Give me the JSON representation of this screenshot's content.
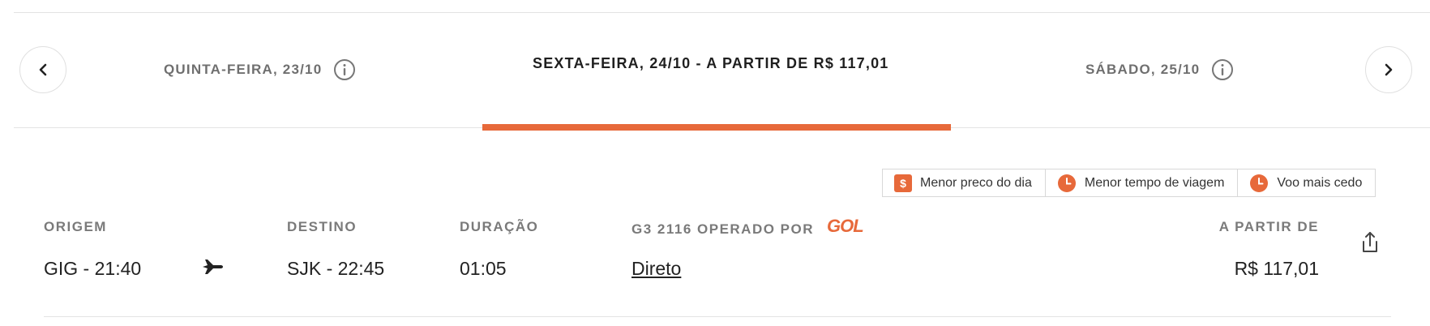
{
  "dates": {
    "previous": {
      "label": "QUINTA-FEIRA, 23/10"
    },
    "active": {
      "label": "SEXTA-FEIRA, 24/10 - A PARTIR DE R$ 117,01"
    },
    "next": {
      "label": "SÁBADO, 25/10"
    }
  },
  "icons": {
    "prev": "chevron-left-icon",
    "next": "chevron-right-icon",
    "info": "info-icon",
    "dollar": "dollar-badge-icon",
    "clock": "clock-icon",
    "plane": "plane-icon",
    "share": "share-icon"
  },
  "legend": {
    "items": [
      {
        "label": "Menor preco do dia",
        "icon": "$"
      },
      {
        "label": "Menor tempo de viagem"
      },
      {
        "label": "Voo mais cedo"
      }
    ]
  },
  "flight": {
    "origin_label": "ORIGEM",
    "origin_value": "GIG - 21:40",
    "destination_label": "DESTINO",
    "destination_value": "SJK - 22:45",
    "duration_label": "DURAÇÃO",
    "duration_value": "01:05",
    "operated_label": "G3 2116 OPERADO POR",
    "airline_logo": "GOL",
    "stops_value": "Direto",
    "price_label": "A PARTIR DE",
    "price_value": "R$ 117,01"
  },
  "colors": {
    "accent": "#e7693a",
    "muted_text": "#6f6f6f",
    "border": "#e3e3e3"
  }
}
